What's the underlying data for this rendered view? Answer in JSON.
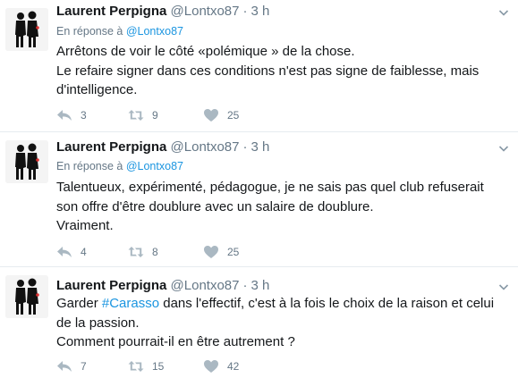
{
  "tweets": [
    {
      "author_name": "Laurent Perpigna",
      "handle": "@Lontxo87",
      "separator": "·",
      "time": "3 h",
      "reply_prefix": "En réponse à",
      "reply_to": "@Lontxo87",
      "lines": [
        "Arrêtons de voir le côté «polémique » de la chose.",
        "Le refaire signer dans ces conditions n'est pas signe de faiblesse, mais d'intelligence."
      ],
      "replies": "3",
      "retweets": "9",
      "likes": "25"
    },
    {
      "author_name": "Laurent Perpigna",
      "handle": "@Lontxo87",
      "separator": "·",
      "time": "3 h",
      "reply_prefix": "En réponse à",
      "reply_to": "@Lontxo87",
      "lines": [
        "Talentueux, expérimenté, pédagogue, je ne sais pas quel club refuserait son offre d'être doublure avec un salaire de doublure.",
        "Vraiment."
      ],
      "replies": "4",
      "retweets": "8",
      "likes": "25"
    },
    {
      "author_name": "Laurent Perpigna",
      "handle": "@Lontxo87",
      "separator": "·",
      "time": "3 h",
      "text_before_hashtag": "Garder ",
      "hashtag": "#Carasso",
      "text_after_hashtag": " dans l'effectif, c'est à la fois le choix de la raison et celui de la passion.",
      "line2": "Comment pourrait-il en être autrement ?",
      "replies": "7",
      "retweets": "15",
      "likes": "42"
    }
  ],
  "icons": {
    "avatar": "silhouette-couple-avatar",
    "menu": "chevron-down-icon",
    "reply": "reply-icon",
    "retweet": "retweet-icon",
    "like": "heart-icon"
  },
  "colors": {
    "link": "#1b95e0",
    "muted": "#657786",
    "icon": "#aab8c2",
    "divider": "#e6ecf0"
  }
}
